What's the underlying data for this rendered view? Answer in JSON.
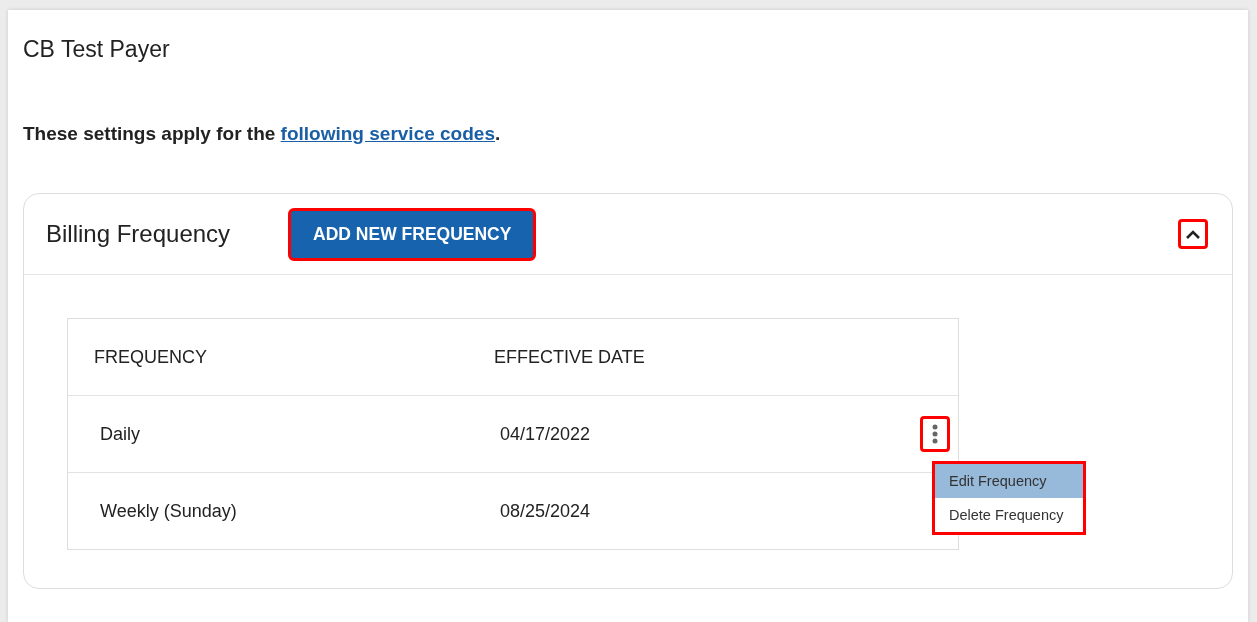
{
  "page_title": "CB Test Payer",
  "note": {
    "before": "These settings apply for the ",
    "link": "following service codes",
    "after": "."
  },
  "panel": {
    "title": "Billing Frequency",
    "expanded": true,
    "toggle_highlighted": true,
    "add_button": {
      "label": "ADD NEW FREQUENCY",
      "highlighted": true
    },
    "table": {
      "columns": [
        "FREQUENCY",
        "EFFECTIVE DATE"
      ],
      "rows": [
        {
          "cells": [
            "Daily",
            "04/17/2022"
          ],
          "menu_button": true,
          "menu_highlighted": true
        },
        {
          "cells": [
            "Weekly (Sunday)",
            "08/25/2024"
          ],
          "menu_button": false
        }
      ]
    },
    "menu": {
      "highlighted": true,
      "items": [
        {
          "label": "Edit Frequency",
          "selected": true
        },
        {
          "label": "Delete Frequency",
          "selected": false
        }
      ]
    }
  }
}
